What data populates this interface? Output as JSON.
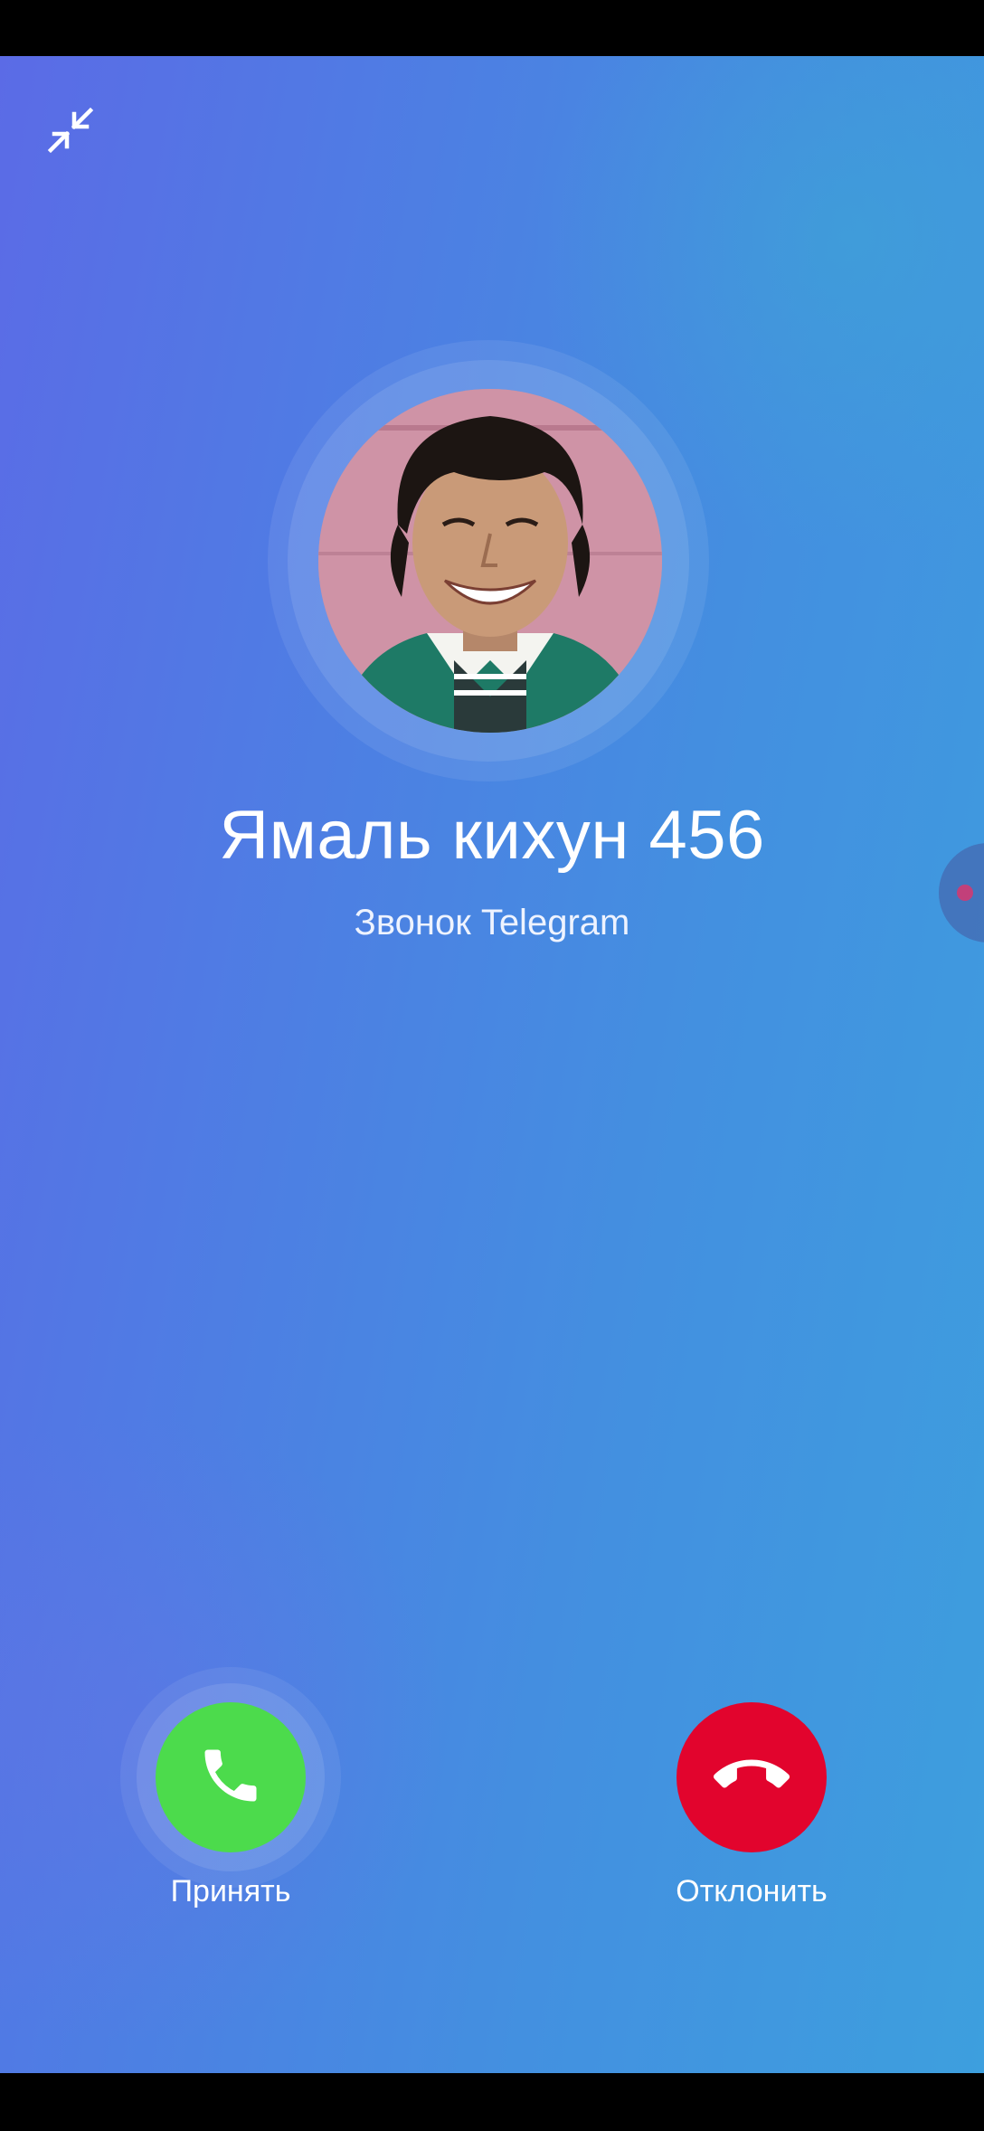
{
  "call": {
    "caller_name": "Ямаль кихун 456",
    "status": "Звонок Telegram"
  },
  "actions": {
    "accept_label": "Принять",
    "decline_label": "Отклонить"
  },
  "icons": {
    "minimize": "minimize-arrows-icon",
    "accept": "phone-icon",
    "decline": "hang-up-icon"
  },
  "colors": {
    "accept": "#4cdb4c",
    "decline": "#e2042d"
  }
}
